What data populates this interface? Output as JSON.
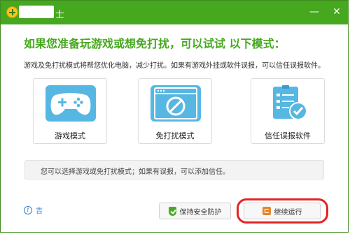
{
  "titlebar": {
    "title": "士"
  },
  "headline": "如果您准备玩游戏或想免打扰，可以试试      以下模式：",
  "subtext": "游戏及免打扰模式将帮您优化电脑，减少打扰。如果有游戏外挂或软件误报，可以信任误报软件。",
  "modes": [
    {
      "label": "游戏模式",
      "icon": "gamepad-icon"
    },
    {
      "label": "免打扰模式",
      "icon": "no-disturb-icon"
    },
    {
      "label": "信任误报软件",
      "icon": "trust-list-icon"
    }
  ],
  "notice": "您可以选择游戏或免打扰模式；如果有误报，可以添加信任。",
  "footer": {
    "help_link": "吉",
    "keep_button": "保持安全防护",
    "continue_button": "继续运行"
  },
  "colors": {
    "brand": "#45a81f",
    "accent_blue": "#57b7e3",
    "highlight": "#e32424"
  }
}
